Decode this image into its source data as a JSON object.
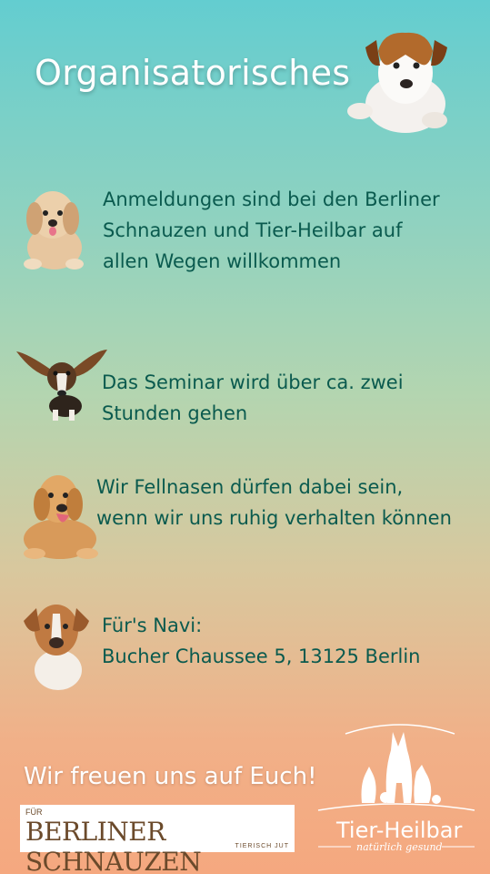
{
  "title": "Organisatorisches",
  "items": [
    {
      "lines": [
        "Anmeldungen sind bei den Berliner",
        "Schnauzen und Tier-Heilbar auf",
        "allen Wegen willkommen"
      ]
    },
    {
      "lines": [
        "Das Seminar wird über ca. zwei",
        "Stunden gehen"
      ]
    },
    {
      "lines": [
        "Wir Fellnasen dürfen dabei sein,",
        "wenn wir uns ruhig verhalten können"
      ]
    },
    {
      "lines": [
        "Für's Navi:",
        "Bucher Chaussee 5, 13125 Berlin"
      ]
    }
  ],
  "footer": {
    "text": "Wir freuen uns auf Euch!"
  },
  "logos": {
    "berliner_schnauzen": {
      "top": "FÜR",
      "name": "BERLINER SCHNAUZEN",
      "sub": "TIERISCH JUT"
    },
    "tier_heilbar": {
      "name": "Tier-Heilbar",
      "tagline": "natürlich gesund"
    }
  }
}
